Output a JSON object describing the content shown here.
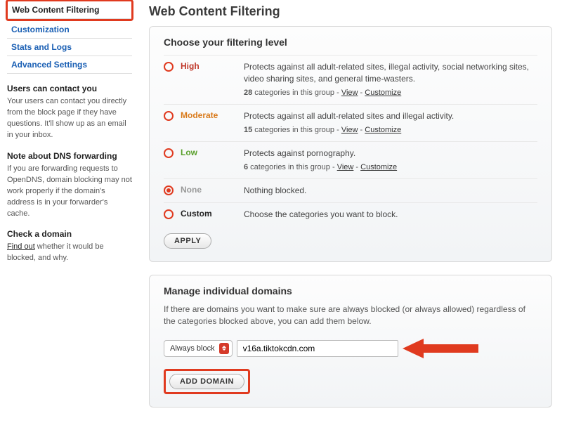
{
  "sidebar": {
    "nav": [
      "Web Content Filtering",
      "Customization",
      "Stats and Logs",
      "Advanced Settings"
    ],
    "blocks": [
      {
        "title": "Users can contact you",
        "text": "Your users can contact you directly from the block page if they have questions. It'll show up as an email in your inbox."
      },
      {
        "title": "Note about DNS forwarding",
        "text": "If you are forwarding requests to OpenDNS, domain blocking may not work properly if the domain's address is in your forwarder's cache."
      },
      {
        "title": "Check a domain",
        "link": "Find out",
        "text_after": " whether it would be blocked, and why."
      }
    ]
  },
  "page": {
    "title": "Web Content Filtering",
    "filtering": {
      "heading": "Choose your filtering level",
      "levels": [
        {
          "key": "high",
          "name": "High",
          "cls": "lvl-high",
          "desc": "Protects against all adult-related sites, illegal activity, social networking sites, video sharing sites, and general time-wasters.",
          "count": "28",
          "meta_mid": " categories in this group - ",
          "view": "View",
          "dash": " - ",
          "cust": "Customize",
          "checked": false
        },
        {
          "key": "moderate",
          "name": "Moderate",
          "cls": "lvl-mod",
          "desc": "Protects against all adult-related sites and illegal activity.",
          "count": "15",
          "meta_mid": " categories in this group - ",
          "view": "View",
          "dash": " - ",
          "cust": "Customize",
          "checked": false
        },
        {
          "key": "low",
          "name": "Low",
          "cls": "lvl-low",
          "desc": "Protects against pornography.",
          "count": "6",
          "meta_mid": " categories in this group - ",
          "view": "View",
          "dash": " - ",
          "cust": "Customize",
          "checked": false
        },
        {
          "key": "none",
          "name": "None",
          "cls": "lvl-none",
          "desc": "Nothing blocked.",
          "checked": true
        },
        {
          "key": "custom",
          "name": "Custom",
          "cls": "lvl-custom",
          "desc": "Choose the categories you want to block.",
          "checked": false
        }
      ],
      "apply": "APPLY"
    },
    "domains": {
      "heading": "Manage individual domains",
      "intro": "If there are domains you want to make sure are always blocked (or always allowed) regardless of the categories blocked above, you can add them below.",
      "select_value": "Always block",
      "input_value": "v16a.tiktokcdn.com",
      "add": "ADD DOMAIN"
    }
  }
}
